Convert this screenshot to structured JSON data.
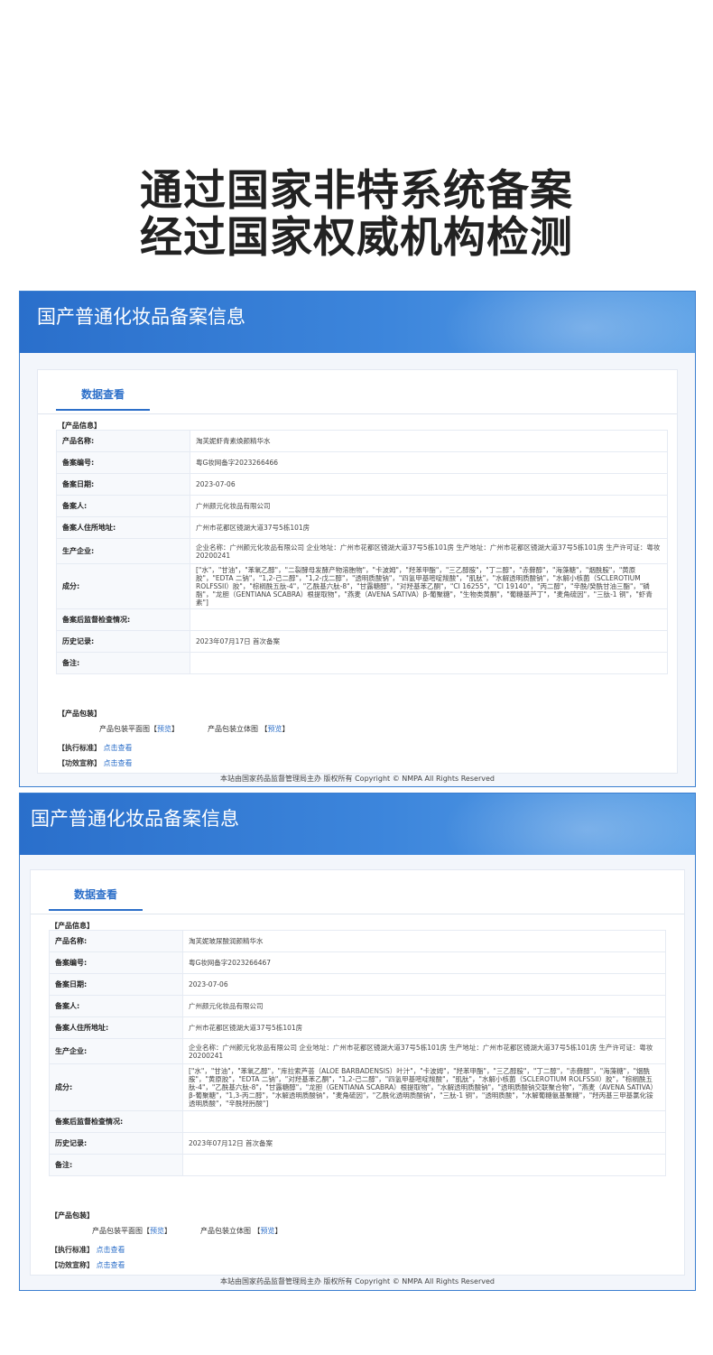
{
  "headline": {
    "line1": "通过国家非特系统备案",
    "line2": "经过国家权威机构检测"
  },
  "records": [
    {
      "banner_title": "国产普通化妆品备案信息",
      "tab_label": "数据查看",
      "product_section": "【产品信息】",
      "rows": [
        {
          "label": "产品名称:",
          "value": "淘芙妮虾青素焕颜精华水"
        },
        {
          "label": "备案编号:",
          "value": "粤G妆网备字2023266466"
        },
        {
          "label": "备案日期:",
          "value": "2023-07-06"
        },
        {
          "label": "备案人:",
          "value": "广州颜元化妆品有限公司"
        },
        {
          "label": "备案人住所地址:",
          "value": "广州市花都区镜湖大道37号5栋101房"
        },
        {
          "label": "生产企业:",
          "value": "企业名称：广州颜元化妆品有限公司 企业地址：广州市花都区镜湖大道37号5栋101房 生产地址：广州市花都区镜湖大道37号5栋101房 生产许可证：粤妆20200241"
        },
        {
          "label": "成分:",
          "value": "[\"水\"，\"甘油\"，\"苯氧乙醇\"，\"二裂酵母发酵产物溶胞物\"，\"卡波姆\"，\"羟苯甲酯\"，\"三乙醇胺\"，\"丁二醇\"，\"赤藓醇\"，\"海藻糖\"，\"烟酰胺\"，\"黄原胶\"，\"EDTA 二钠\"，\"1,2-己二醇\"，\"1,2-戊二醇\"，\"透明质酸钠\"，\"四氢甲基嘧啶羧酸\"，\"肌肽\"，\"水解透明质酸钠\"，\"水解小核菌（SCLEROTIUM ROLFSSII）胶\"，\"棕榈酰五肽-4\"，\"乙酰基六肽-8\"，\"甘露糖醇\"，\"对羟基苯乙酮\"，\"CI 16255\"，\"CI 19140\"，\"丙二醇\"，\"辛酰/癸酰甘油三酯\"，\"磷脂\"，\"龙胆（GENTIANA SCABRA）根提取物\"，\"燕麦（AVENA SATIVA）β-葡聚糖\"，\"生物类黄酮\"，\"葡糖基芦丁\"，\"麦角硫因\"，\"三肽-1 铜\"，\"虾青素\"]"
        },
        {
          "label": "备案后监督检查情况:",
          "value": ""
        },
        {
          "label": "历史记录:",
          "value": "2023年07月17日 首次备案"
        },
        {
          "label": "备注:",
          "value": ""
        }
      ],
      "package_section": "【产品包装】",
      "flat_label": "产品包装平面图",
      "flat_link": "预览",
      "solid_label": "产品包装立体图",
      "solid_link": "预览",
      "standard_label": "【执行标准】",
      "standard_link": "点击查看",
      "efficacy_label": "【功效宣称】",
      "efficacy_link": "点击查看",
      "footer": "本站由国家药品监督管理局主办 版权所有 Copyright © NMPA All Rights Reserved"
    },
    {
      "banner_title": "国产普通化妆品备案信息",
      "tab_label": "数据查看",
      "product_section": "【产品信息】",
      "rows": [
        {
          "label": "产品名称:",
          "value": "淘芙妮玻尿酸润颜精华水"
        },
        {
          "label": "备案编号:",
          "value": "粤G妆网备字2023266467"
        },
        {
          "label": "备案日期:",
          "value": "2023-07-06"
        },
        {
          "label": "备案人:",
          "value": "广州颜元化妆品有限公司"
        },
        {
          "label": "备案人住所地址:",
          "value": "广州市花都区镜湖大道37号5栋101房"
        },
        {
          "label": "生产企业:",
          "value": "企业名称：广州颜元化妆品有限公司 企业地址：广州市花都区镜湖大道37号5栋101房 生产地址：广州市花都区镜湖大道37号5栋101房 生产许可证：粤妆20200241"
        },
        {
          "label": "成分:",
          "value": "[\"水\"，\"甘油\"，\"苯氧乙醇\"，\"库拉索芦荟（ALOE BARBADENSIS）叶汁\"，\"卡波姆\"，\"羟苯甲酯\"，\"三乙醇胺\"，\"丁二醇\"，\"赤藓醇\"，\"海藻糖\"，\"烟酰胺\"，\"黄原胶\"，\"EDTA 二钠\"，\"对羟基苯乙酮\"，\"1,2-己二醇\"，\"四氢甲基嘧啶羧酸\"，\"肌肽\"，\"水解小核菌（SCLEROTIUM ROLFSSII）胶\"，\"棕榈酰五肽-4\"，\"乙酰基六肽-8\"，\"甘露糖醇\"，\"龙胆（GENTIANA SCABRA）根提取物\"，\"水解透明质酸钠\"，\"透明质酸钠交联聚合物\"，\"燕麦（AVENA SATIVA）β-葡聚糖\"，\"1,3-丙二醇\"，\"水解透明质酸钠\"，\"麦角硫因\"，\"乙酰化透明质酸钠\"，\"三肽-1 铜\"，\"透明质酸\"，\"水解葡糖氨基聚糖\"，\"羟丙基三甲基氯化铵透明质酸\"，\"辛酰羟肟酸\"]"
        },
        {
          "label": "备案后监督检查情况:",
          "value": ""
        },
        {
          "label": "历史记录:",
          "value": "2023年07月12日 首次备案"
        },
        {
          "label": "备注:",
          "value": ""
        }
      ],
      "package_section": "【产品包装】",
      "flat_label": "产品包装平面图",
      "flat_link": "预览",
      "solid_label": "产品包装立体图",
      "solid_link": "预览",
      "standard_label": "【执行标准】",
      "standard_link": "点击查看",
      "efficacy_label": "【功效宣称】",
      "efficacy_link": "点击查看",
      "footer": "本站由国家药品监督管理局主办 版权所有 Copyright © NMPA All Rights Reserved"
    }
  ]
}
